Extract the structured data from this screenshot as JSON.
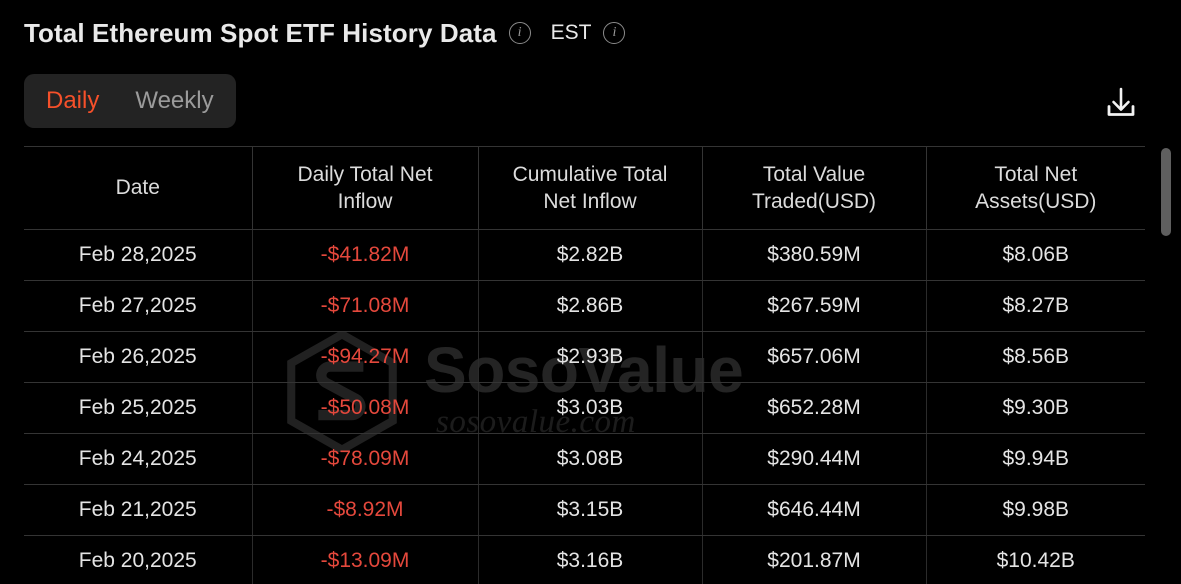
{
  "header": {
    "title": "Total Ethereum Spot ETF History Data",
    "title_info_icon": "info-icon",
    "timezone_label": "EST",
    "timezone_info_icon": "info-icon"
  },
  "toolbar": {
    "segments": [
      {
        "label": "Daily",
        "active": true
      },
      {
        "label": "Weekly",
        "active": false
      }
    ],
    "download_icon": "download-icon"
  },
  "watermark": {
    "brand": "SosoValue",
    "domain": "sosovalue.com",
    "logo_icon": "sosovalue-cube-logo-icon"
  },
  "colors": {
    "background": "#000000",
    "accent": "#f5502a",
    "negative": "#e4483c",
    "text": "#e8e8e8",
    "muted": "#9b9b9b",
    "border": "#343434",
    "toggle_bg": "#232323",
    "scrollbar_thumb": "#5f5f5f"
  },
  "table": {
    "columns": [
      "Date",
      "Daily Total Net Inflow",
      "Cumulative Total Net Inflow",
      "Total Value Traded(USD)",
      "Total Net Assets(USD)"
    ],
    "column_lines": [
      [
        "Date"
      ],
      [
        "Daily Total Net",
        "Inflow"
      ],
      [
        "Cumulative Total",
        "Net Inflow"
      ],
      [
        "Total Value",
        "Traded(USD)"
      ],
      [
        "Total Net",
        "Assets(USD)"
      ]
    ],
    "rows": [
      {
        "date": "Feb 28,2025",
        "daily_net_inflow": "-$41.82M",
        "daily_negative": true,
        "cumulative_net_inflow": "$2.82B",
        "total_value_traded": "$380.59M",
        "total_net_assets": "$8.06B"
      },
      {
        "date": "Feb 27,2025",
        "daily_net_inflow": "-$71.08M",
        "daily_negative": true,
        "cumulative_net_inflow": "$2.86B",
        "total_value_traded": "$267.59M",
        "total_net_assets": "$8.27B"
      },
      {
        "date": "Feb 26,2025",
        "daily_net_inflow": "-$94.27M",
        "daily_negative": true,
        "cumulative_net_inflow": "$2.93B",
        "total_value_traded": "$657.06M",
        "total_net_assets": "$8.56B"
      },
      {
        "date": "Feb 25,2025",
        "daily_net_inflow": "-$50.08M",
        "daily_negative": true,
        "cumulative_net_inflow": "$3.03B",
        "total_value_traded": "$652.28M",
        "total_net_assets": "$9.30B"
      },
      {
        "date": "Feb 24,2025",
        "daily_net_inflow": "-$78.09M",
        "daily_negative": true,
        "cumulative_net_inflow": "$3.08B",
        "total_value_traded": "$290.44M",
        "total_net_assets": "$9.94B"
      },
      {
        "date": "Feb 21,2025",
        "daily_net_inflow": "-$8.92M",
        "daily_negative": true,
        "cumulative_net_inflow": "$3.15B",
        "total_value_traded": "$646.44M",
        "total_net_assets": "$9.98B"
      },
      {
        "date": "Feb 20,2025",
        "daily_net_inflow": "-$13.09M",
        "daily_negative": true,
        "cumulative_net_inflow": "$3.16B",
        "total_value_traded": "$201.87M",
        "total_net_assets": "$10.42B"
      }
    ]
  }
}
